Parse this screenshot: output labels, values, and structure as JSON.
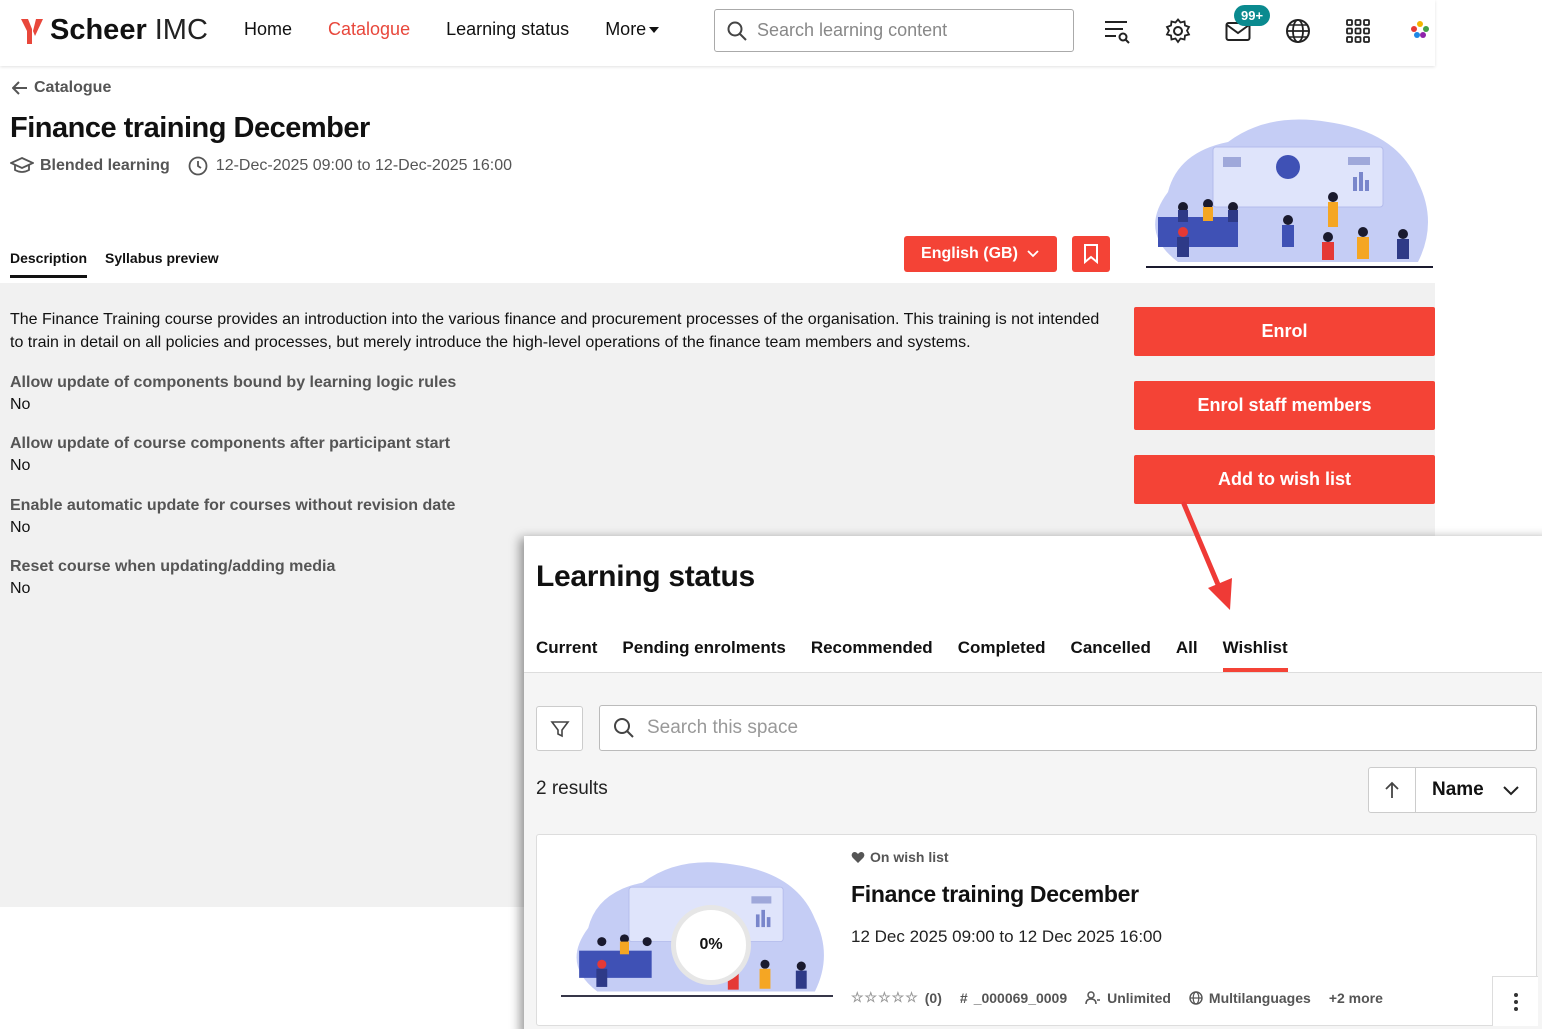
{
  "header": {
    "logo_bold": "Scheer",
    "logo_regular": "IMC",
    "nav": {
      "home": "Home",
      "catalogue": "Catalogue",
      "learning_status": "Learning status",
      "more": "More"
    },
    "search_placeholder": "Search learning content",
    "notification_badge": "99+"
  },
  "course": {
    "back_label": "Catalogue",
    "title": "Finance training December",
    "type": "Blended learning",
    "date_range": "12-Dec-2025 09:00 to 12-Dec-2025 16:00",
    "tabs": {
      "description": "Description",
      "syllabus": "Syllabus preview"
    },
    "language": "English (GB)",
    "description": "The Finance Training course provides an introduction into the various finance and procurement processes of the organisation. This training is not intended to train in detail on all policies and processes, but merely introduce the high-level operations of the finance team members and systems.",
    "fields": [
      {
        "label": "Allow update of components bound by learning logic rules",
        "value": "No"
      },
      {
        "label": "Allow update of course components after participant start",
        "value": "No"
      },
      {
        "label": "Enable automatic update for courses without revision date",
        "value": "No"
      },
      {
        "label": "Reset course when updating/adding media",
        "value": "No"
      }
    ],
    "actions": {
      "enrol": "Enrol",
      "enrol_staff": "Enrol staff members",
      "wishlist": "Add to wish list"
    }
  },
  "learning_status": {
    "title": "Learning status",
    "tabs": {
      "current": "Current",
      "pending": "Pending enrolments",
      "recommended": "Recommended",
      "completed": "Completed",
      "cancelled": "Cancelled",
      "all": "All",
      "wishlist": "Wishlist"
    },
    "search_placeholder": "Search this space",
    "results": "2 results",
    "sort_by": "Name",
    "card": {
      "tag": "On wish list",
      "title": "Finance training December",
      "date": "12 Dec 2025 09:00 to 12 Dec 2025 16:00",
      "progress": "0%",
      "rating_count": "(0)",
      "code": "_000069_0009",
      "capacity": "Unlimited",
      "language": "Multilanguages",
      "more": "+2 more"
    }
  },
  "colors": {
    "accent": "#f44336",
    "badge": "#0a8a8f",
    "illustration": "#c5cdf5"
  }
}
